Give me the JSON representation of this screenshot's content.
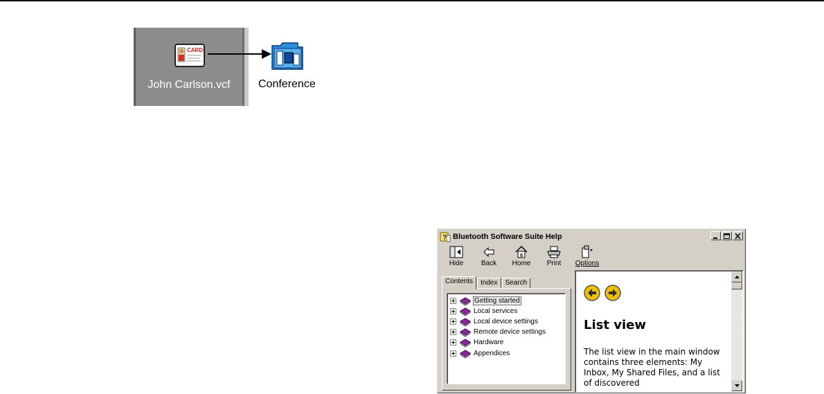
{
  "drag_illustration": {
    "file_label": "John Carlson.vcf",
    "card_icon_text": "CARD",
    "target_label": "Conference"
  },
  "help_window": {
    "title": "Bluetooth Software Suite Help",
    "toolbar": {
      "hide": "Hide",
      "back": "Back",
      "home": "Home",
      "print": "Print",
      "options": "Options"
    },
    "tabs": [
      "Contents",
      "Index",
      "Search"
    ],
    "tree_items": [
      "Getting started",
      "Local services",
      "Local device settings",
      "Remote device settings",
      "Hardware",
      "Appendices"
    ],
    "topic": {
      "title": "List view",
      "body": "The list view in the main window contains three elements: My Inbox, My Shared Files, and a list of discovered"
    }
  }
}
